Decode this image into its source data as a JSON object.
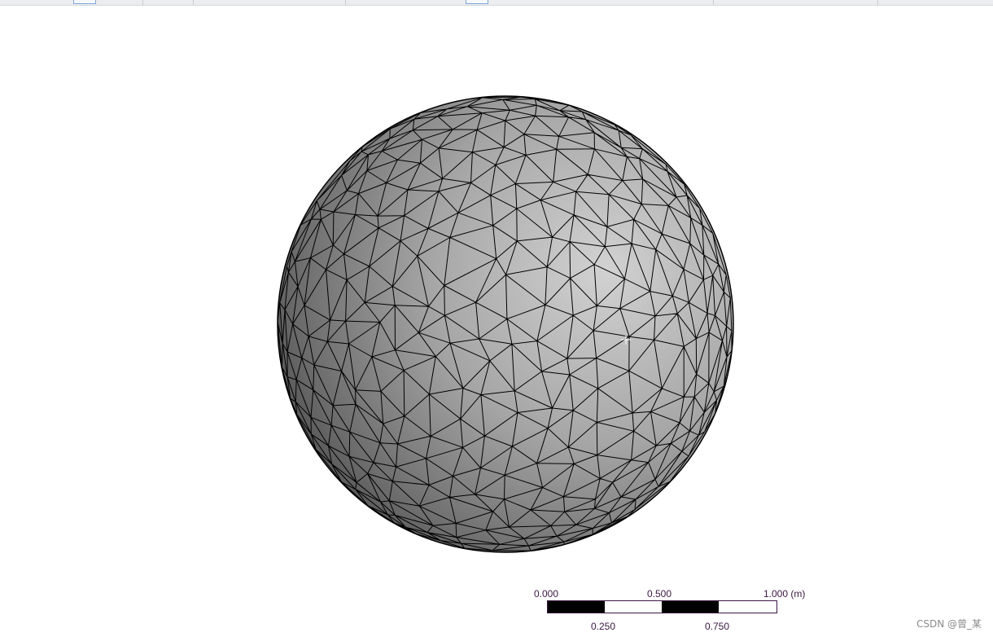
{
  "viewport": {
    "mesh_view": "sphere-tetrahedral-mesh",
    "colors": {
      "surface_light": "#cfcfcf",
      "surface_dark": "#3f3f3f",
      "edges": "#000000",
      "cursor": "#ffffff"
    }
  },
  "scale_bar": {
    "top_labels": [
      "0.000",
      "0.500",
      "1.000 (m)"
    ],
    "bottom_labels": [
      "0.250",
      "0.750"
    ],
    "colors": {
      "fill": "#000000",
      "outline": "#3b1742"
    }
  },
  "watermark": "CSDN @曾_某"
}
